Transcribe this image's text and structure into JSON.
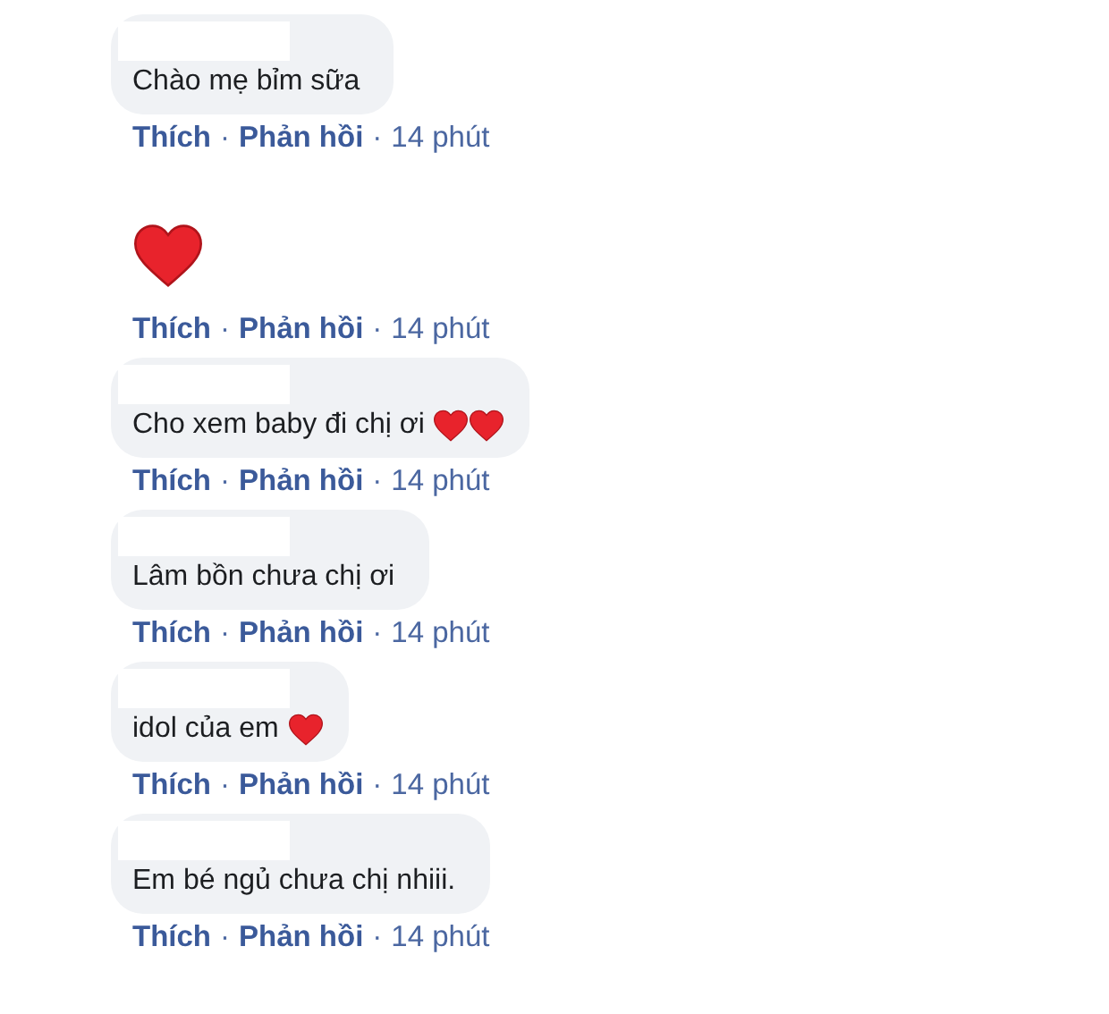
{
  "comments": [
    {
      "kind": "bubble",
      "name_hidden": true,
      "content": [
        {
          "kind": "text",
          "text": "Chào mẹ bỉm sữa"
        }
      ],
      "actions": [
        {
          "kind": "link",
          "text": "Thích"
        },
        {
          "kind": "sep",
          "text": "·"
        },
        {
          "kind": "link",
          "text": "Phản hồi"
        },
        {
          "kind": "sep",
          "text": "·"
        },
        {
          "kind": "time",
          "text": "14 phút"
        }
      ]
    },
    {
      "kind": "sticker",
      "content": [
        {
          "kind": "heart"
        }
      ],
      "actions": [
        {
          "kind": "link",
          "text": "Thích"
        },
        {
          "kind": "sep",
          "text": "·"
        },
        {
          "kind": "link",
          "text": "Phản hồi"
        },
        {
          "kind": "sep",
          "text": "·"
        },
        {
          "kind": "time",
          "text": "14 phút"
        }
      ]
    },
    {
      "kind": "bubble",
      "name_hidden": true,
      "content": [
        {
          "kind": "text",
          "text": "Cho xem baby đi chị ơi"
        },
        {
          "kind": "heart"
        },
        {
          "kind": "heart"
        }
      ],
      "actions": [
        {
          "kind": "link",
          "text": "Thích"
        },
        {
          "kind": "sep",
          "text": "·"
        },
        {
          "kind": "link",
          "text": "Phản hồi"
        },
        {
          "kind": "sep",
          "text": "·"
        },
        {
          "kind": "time",
          "text": "14 phút"
        }
      ]
    },
    {
      "kind": "bubble",
      "name_hidden": true,
      "content": [
        {
          "kind": "text",
          "text": "Lâm bồn chưa chị ơi"
        }
      ],
      "actions": [
        {
          "kind": "link",
          "text": "Thích"
        },
        {
          "kind": "sep",
          "text": "·"
        },
        {
          "kind": "link",
          "text": "Phản hồi"
        },
        {
          "kind": "sep",
          "text": "·"
        },
        {
          "kind": "time",
          "text": "14 phút"
        }
      ]
    },
    {
      "kind": "bubble",
      "name_hidden": true,
      "content": [
        {
          "kind": "text",
          "text": "idol của em"
        },
        {
          "kind": "heart"
        }
      ],
      "actions": [
        {
          "kind": "link",
          "text": "Thích"
        },
        {
          "kind": "sep",
          "text": "·"
        },
        {
          "kind": "link",
          "text": "Phản hồi"
        },
        {
          "kind": "sep",
          "text": "·"
        },
        {
          "kind": "time",
          "text": "14 phút"
        }
      ]
    },
    {
      "kind": "bubble",
      "name_hidden": true,
      "content": [
        {
          "kind": "text",
          "text": "Em bé ngủ chưa chị nhiii."
        }
      ],
      "actions": [
        {
          "kind": "link",
          "text": "Thích"
        },
        {
          "kind": "sep",
          "text": "·"
        },
        {
          "kind": "link",
          "text": "Phản hồi"
        },
        {
          "kind": "sep",
          "text": "·"
        },
        {
          "kind": "time",
          "text": "14 phút"
        }
      ]
    }
  ]
}
